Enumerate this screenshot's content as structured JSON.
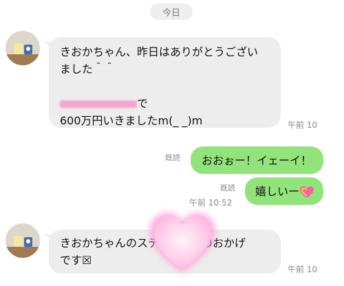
{
  "date_divider": "今日",
  "messages": [
    {
      "line1": "きおかちゃん、昨日はありがとうござい",
      "line2": "ました＾＾",
      "line3_suffix": "で",
      "line4": "600万円いきましたm(_ _)m",
      "time": "午前 10"
    },
    {
      "text": "おおぉー！イェーイ！",
      "read": "既読"
    },
    {
      "text": "嬉しいー",
      "read": "既読",
      "time": "午前 10:52"
    },
    {
      "line1_prefix": "きおかちゃんのステ",
      "line1_suffix": "のおかげ",
      "line2": "です☒",
      "time": "午前 10"
    }
  ],
  "colors": {
    "incoming_bubble": "#ededed",
    "outgoing_bubble": "#92e37b",
    "sticker_heart": "#ffc6e6"
  },
  "icons": {
    "emoji": "sparkling-heart-icon",
    "sticker": "heart-sticker"
  }
}
